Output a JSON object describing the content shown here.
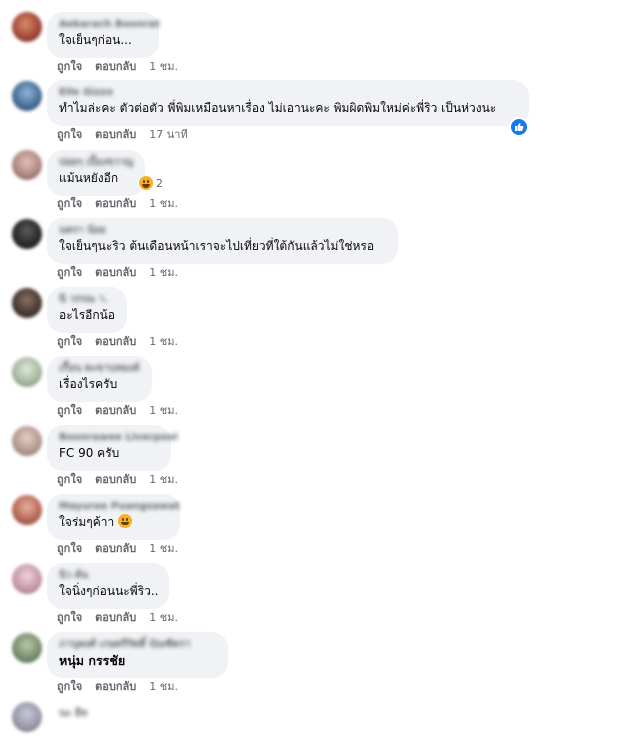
{
  "actions": {
    "like": "ถูกใจ",
    "reply": "ตอบกลับ"
  },
  "comments": [
    {
      "author": "Aekarach Boonrat",
      "text": "ใจเย็นๆก่อน...",
      "time": "1 ชม."
    },
    {
      "author": "Elle Gizzo",
      "text": "ทำไมล่ะคะ ตัวต่อตัว พี่พิมเหมือนหาเรื่อง ไม่เอานะคะ พิมผิดพิมใหม่ค่ะพี่ริว เป็นห่วงนะ",
      "time": "17 นาที"
    },
    {
      "author": "ปอยๆ เบื้องขวาญ",
      "text": "แม้นหยังอีก",
      "time": "1 ชม.",
      "reaction_count": "2"
    },
    {
      "author": "นครา น้อย",
      "text": "ใจเย็นๆนะริว ต้นเดือนหน้าเราจะไปเที่ยวที่ใต้กันแล้วไม่ใช่หรอ",
      "time": "1 ชม."
    },
    {
      "author": "นี วรรณ า.",
      "text": "อะไรอีกน้อ",
      "time": "1 ชม."
    },
    {
      "author": "เกื้อน ตะขาบทองค์",
      "text": "เรื่องไรครับ",
      "time": "1 ชม."
    },
    {
      "author": "Boonrawee Liverpool",
      "text": "FC 90 ครับ",
      "time": "1 ชม."
    },
    {
      "author": "Mayuree Puangsawat",
      "text": "ใจร่มๆค้าา",
      "time": "1 ชม."
    },
    {
      "author": "นิว ต้น",
      "text": "ใจนิ่งๆก่อนนะพี่ริว..",
      "time": "1 ชม."
    },
    {
      "author": "ภานุพงศ์ เกษตรีรัตติ์ บัณฑิตรา",
      "text": "หนุ่ม กรรชัย",
      "time": "1 ชม."
    },
    {
      "author": "นะ อีท",
      "text": ""
    }
  ]
}
